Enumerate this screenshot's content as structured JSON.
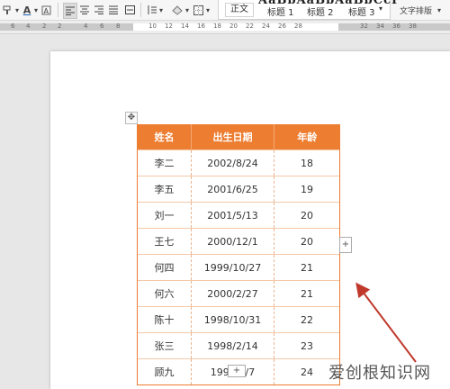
{
  "ribbon": {
    "font_color_glyph": "A",
    "highlight_glyph": "A",
    "styles": {
      "preview_text": "AaBbAaBbAaBbCcI",
      "body_text": "正文",
      "heading1": "标题 1",
      "heading2": "标题 2",
      "heading3": "标题 3"
    },
    "text_layout": "文字排版"
  },
  "ruler": {
    "numbers": [
      "6",
      "4",
      "2",
      "2",
      "4",
      "6",
      "8",
      "10",
      "12",
      "14",
      "16",
      "18",
      "20",
      "22",
      "24",
      "26",
      "28",
      "32",
      "34",
      "36",
      "38"
    ]
  },
  "table": {
    "headers": [
      "姓名",
      "出生日期",
      "年龄"
    ],
    "rows": [
      [
        "李二",
        "2002/8/24",
        "18"
      ],
      [
        "李五",
        "2001/6/25",
        "19"
      ],
      [
        "刘一",
        "2001/5/13",
        "20"
      ],
      [
        "王七",
        "2000/12/1",
        "20"
      ],
      [
        "何四",
        "1999/10/27",
        "21"
      ],
      [
        "何六",
        "2000/2/27",
        "21"
      ],
      [
        "陈十",
        "1998/10/31",
        "22"
      ],
      [
        "张三",
        "1998/2/14",
        "23"
      ],
      [
        "顾九",
        "1997/3/7",
        "24"
      ]
    ],
    "header_color": "#ed7d31",
    "add_row_symbol": "+",
    "add_column_symbol": "+",
    "move_symbol": "✥"
  },
  "watermark": "爱创根知识网",
  "colors": {
    "arrow": "#c0392b"
  }
}
